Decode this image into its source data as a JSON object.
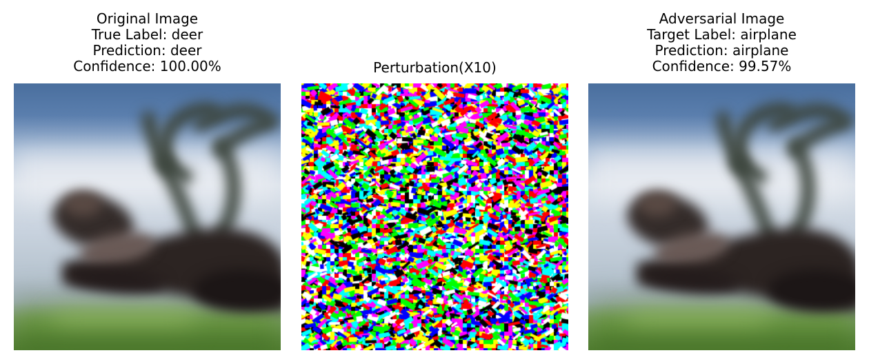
{
  "panels": [
    {
      "title_lines": [
        "Original Image",
        "True Label: deer",
        "Prediction: deer",
        "Confidence: 100.00%"
      ],
      "image": "blurry-deer-photo"
    },
    {
      "title_lines": [
        "Perturbation(X10)"
      ],
      "image": "colorful-noise-perturbation"
    },
    {
      "title_lines": [
        "Adversarial Image",
        "Target Label: airplane",
        "Prediction: airplane",
        "Confidence: 99.57%"
      ],
      "image": "blurry-deer-photo-adversarial"
    }
  ],
  "colors": {
    "noise_palette": [
      "#ffffff",
      "#000000",
      "#ff0000",
      "#00ff00",
      "#0000ff",
      "#00ffff",
      "#ff00ff",
      "#ffff00"
    ]
  }
}
